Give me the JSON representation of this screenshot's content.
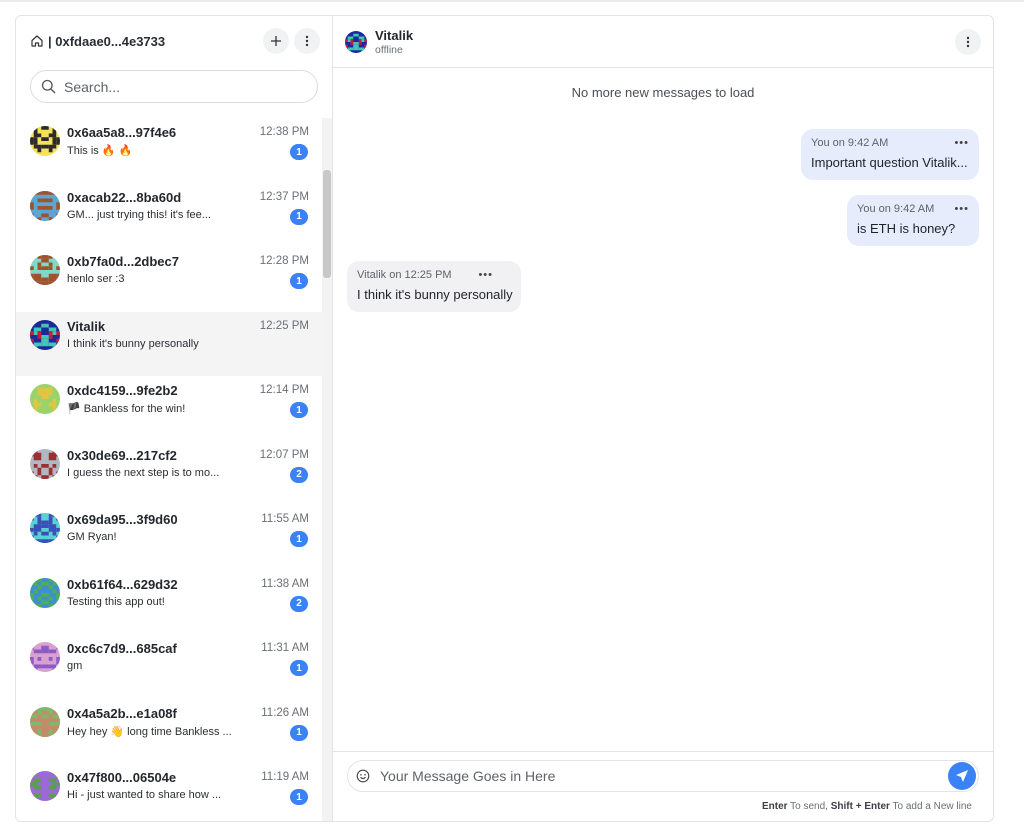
{
  "account": {
    "title": "| 0xfdaae0...4e3733"
  },
  "search": {
    "placeholder": "Search..."
  },
  "conversations": [
    {
      "name": "0x6aa5a8...97f4e6",
      "preview": "This is 🔥 🔥",
      "time": "12:38 PM",
      "unread": "1",
      "avatar_colors": [
        "#f6e15a",
        "#2b2b2b",
        "#f6e15a"
      ]
    },
    {
      "name": "0xacab22...8ba60d",
      "preview": "GM... just trying this! it's fee...",
      "time": "12:37 PM",
      "unread": "1",
      "avatar_colors": [
        "#5aa7d6",
        "#a0522d",
        "#5aa7d6"
      ]
    },
    {
      "name": "0xb7fa0d...2dbec7",
      "preview": "henlo ser :3",
      "time": "12:28 PM",
      "unread": "1",
      "avatar_colors": [
        "#7fd9c8",
        "#a0522d",
        "#7fd9c8"
      ]
    },
    {
      "name": "Vitalik",
      "preview": "I think it's bunny personally",
      "time": "12:25 PM",
      "unread": "",
      "avatar_colors": [
        "#1a2a9c",
        "#c41e3a",
        "#46c4b4"
      ]
    },
    {
      "name": "0xdc4159...9fe2b2",
      "preview": "🏴 Bankless for the win!",
      "time": "12:14 PM",
      "unread": "1",
      "avatar_colors": [
        "#9bd36b",
        "#e0c640",
        "#9bd36b"
      ]
    },
    {
      "name": "0x30de69...217cf2",
      "preview": "I guess the next step is to mo...",
      "time": "12:07 PM",
      "unread": "2",
      "avatar_colors": [
        "#b0b8c4",
        "#9c2f2f",
        "#b0b8c4"
      ]
    },
    {
      "name": "0x69da95...3f9d60",
      "preview": "GM Ryan!",
      "time": "11:55 AM",
      "unread": "1",
      "avatar_colors": [
        "#5ad1d1",
        "#3a4fb8",
        "#5ad1d1"
      ]
    },
    {
      "name": "0xb61f64...629d32",
      "preview": "Testing this app out!",
      "time": "11:38 AM",
      "unread": "2",
      "avatar_colors": [
        "#3f8fd0",
        "#4db04d",
        "#3f8fd0"
      ]
    },
    {
      "name": "0xc6c7d9...685caf",
      "preview": "gm",
      "time": "11:31 AM",
      "unread": "1",
      "avatar_colors": [
        "#d9a0d0",
        "#8a5cc4",
        "#d9a0d0"
      ]
    },
    {
      "name": "0x4a5a2b...e1a08f",
      "preview": "Hey hey 👋 long time Bankless ...",
      "time": "11:26 AM",
      "unread": "1",
      "avatar_colors": [
        "#7fb86a",
        "#c48a6a",
        "#7fb86a"
      ]
    },
    {
      "name": "0x47f800...06504e",
      "preview": "Hi - just wanted to share how ...",
      "time": "11:19 AM",
      "unread": "1",
      "avatar_colors": [
        "#9c6ad6",
        "#5aa04a",
        "#9c6ad6"
      ]
    }
  ],
  "chat": {
    "name": "Vitalik",
    "status": "offline",
    "no_more": "No more new messages to load",
    "messages": [
      {
        "sender": "You on 9:42 AM",
        "text": "Important question Vitalik...",
        "mine": true
      },
      {
        "sender": "You on 9:42 AM",
        "text": "is ETH is honey?",
        "mine": true
      },
      {
        "sender": "Vitalik on 12:25 PM",
        "text": "I think it's bunny personally",
        "mine": false
      }
    ]
  },
  "composer": {
    "placeholder": "Your Message Goes in Here",
    "hint_enter": "Enter",
    "hint_send": " To send, ",
    "hint_shift": "Shift + Enter",
    "hint_newline": " To add a New line"
  },
  "colors": {
    "accent": "#3b82f6",
    "mine_bubble": "#e6ecfb",
    "theirs_bubble": "#f1f1f3",
    "active_row": "#f4f4f5"
  },
  "icons": {
    "home": "home-icon",
    "plus": "plus-icon",
    "more": "more-vertical-icon",
    "search": "search-icon",
    "emoji": "emoji-icon",
    "send": "send-icon"
  }
}
